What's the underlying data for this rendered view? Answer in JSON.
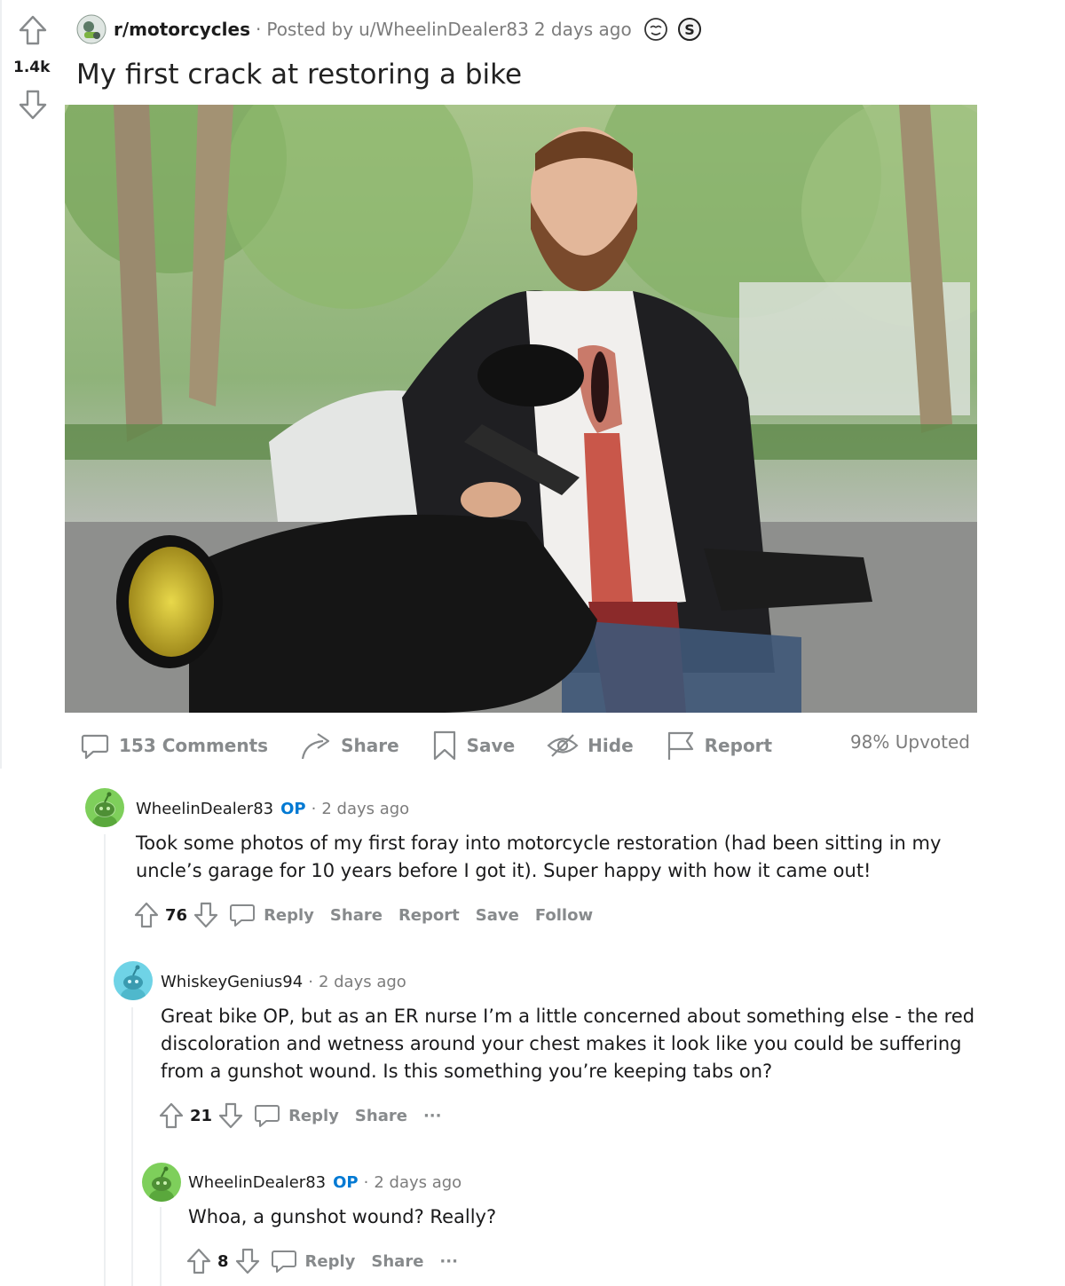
{
  "post": {
    "subreddit": "r/motorcycles",
    "posted_by_prefix": "Posted by",
    "author": "u/WheelinDealer83",
    "age": "2 days ago",
    "score": "1.4k",
    "title": "My first crack at restoring a bike",
    "actions": {
      "comments": "153 Comments",
      "share": "Share",
      "save": "Save",
      "hide": "Hide",
      "report": "Report"
    },
    "upvoted": "98% Upvoted"
  },
  "comments": [
    {
      "user": "WheelinDealer83",
      "op": "OP",
      "age": "2 days ago",
      "body": "Took some photos of my first foray into motorcycle restoration (had been sitting in my uncle’s garage for 10 years before I got it). Super happy with how it came out!",
      "score": "76",
      "actions": [
        "Reply",
        "Share",
        "Report",
        "Save",
        "Follow"
      ]
    },
    {
      "user": "WhiskeyGenius94",
      "age": "2 days ago",
      "body": "Great bike OP, but as an ER nurse I’m a little concerned about something else - the red discoloration and wetness around your chest makes it look like you could be suffering from a gunshot wound. Is this something you’re keeping tabs on?",
      "score": "21",
      "actions": [
        "Reply",
        "Share"
      ],
      "more": "···"
    },
    {
      "user": "WheelinDealer83",
      "op": "OP",
      "age": "2 days ago",
      "body": "Whoa, a gunshot wound? Really?",
      "score": "8",
      "actions": [
        "Reply",
        "Share"
      ],
      "more": "···"
    }
  ],
  "colors": {
    "op_blue": "#0079d3",
    "muted_gray": "#878a8c",
    "avatar_green": "#7ecf5b",
    "avatar_teal": "#6fd3e6"
  },
  "icons": [
    "upvote-icon",
    "downvote-icon",
    "comment-icon",
    "share-icon",
    "save-icon",
    "hide-icon",
    "report-icon",
    "award-icon",
    "silver-award-icon",
    "snoo-avatar-icon",
    "more-icon"
  ]
}
